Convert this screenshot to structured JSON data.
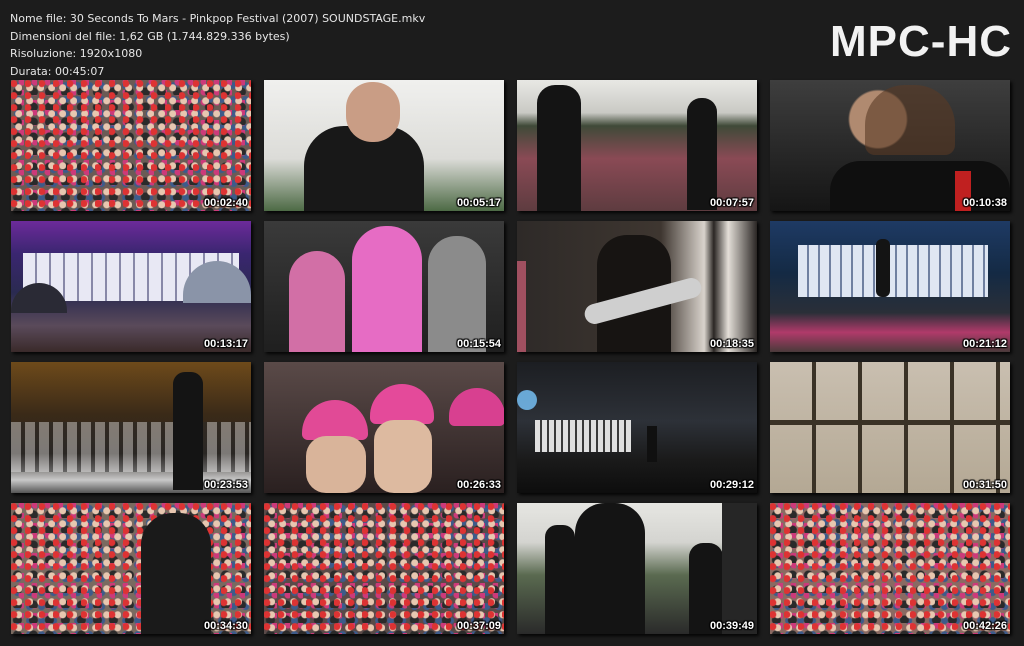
{
  "info": {
    "filename": "Nome file: 30 Seconds To Mars - Pinkpop Festival (2007) SOUNDSTAGE.mkv",
    "filesize": "Dimensioni del file: 1,62 GB (1.744.829.336 bytes)",
    "resolution": "Risoluzione: 1920x1080",
    "duration": "Durata: 00:45:07"
  },
  "logo": "MPC-HC",
  "thumbs": [
    {
      "time": "00:02:40"
    },
    {
      "time": "00:05:17"
    },
    {
      "time": "00:07:57"
    },
    {
      "time": "00:10:38"
    },
    {
      "time": "00:13:17"
    },
    {
      "time": "00:15:54"
    },
    {
      "time": "00:18:35"
    },
    {
      "time": "00:21:12"
    },
    {
      "time": "00:23:53"
    },
    {
      "time": "00:26:33"
    },
    {
      "time": "00:29:12"
    },
    {
      "time": "00:31:50"
    },
    {
      "time": "00:34:30"
    },
    {
      "time": "00:37:09"
    },
    {
      "time": "00:39:49"
    },
    {
      "time": "00:42:26"
    }
  ]
}
